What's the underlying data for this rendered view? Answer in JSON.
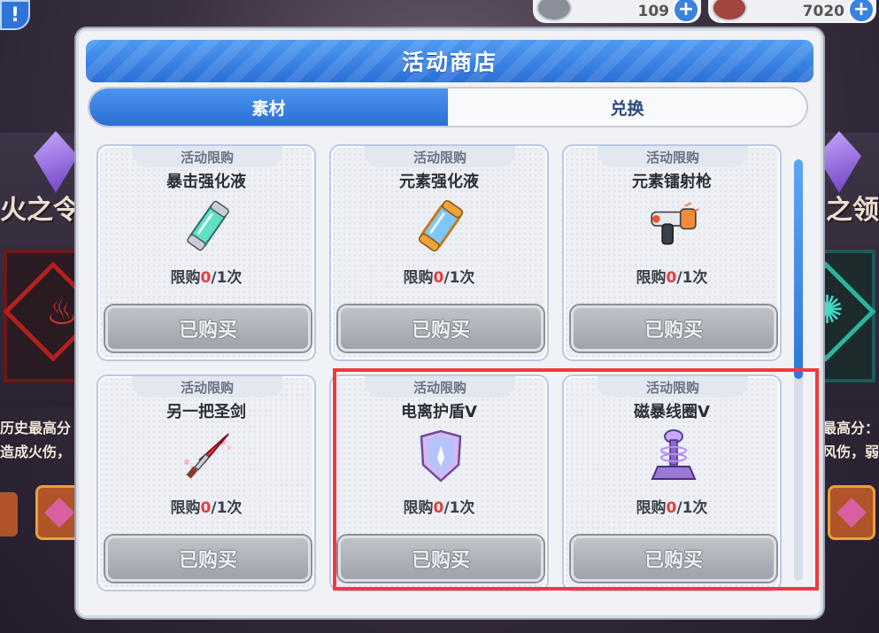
{
  "resources": {
    "key_count": "109",
    "gem_count": "7020"
  },
  "background": {
    "title_left": "火之令",
    "title_right": "之领",
    "text_left_1": "历史最高分",
    "text_left_2": "造成火伤，",
    "text_right_1": "最高分：",
    "text_right_2": "风伤，弱"
  },
  "modal": {
    "title": "活动商店",
    "tabs": [
      {
        "label": "素材",
        "active": true
      },
      {
        "label": "兑换",
        "active": false
      }
    ]
  },
  "shop": {
    "items": [
      {
        "tag": "活动限购",
        "name": "暴击强化液",
        "icon": "green-vial-icon",
        "limit_prefix": "限购",
        "bought": "0",
        "limit_suffix": "/1次",
        "button": "已购买"
      },
      {
        "tag": "活动限购",
        "name": "元素强化液",
        "icon": "blue-vial-icon",
        "limit_prefix": "限购",
        "bought": "0",
        "limit_suffix": "/1次",
        "button": "已购买"
      },
      {
        "tag": "活动限购",
        "name": "元素镭射枪",
        "icon": "laser-gun-icon",
        "limit_prefix": "限购",
        "bought": "0",
        "limit_suffix": "/1次",
        "button": "已购买"
      },
      {
        "tag": "活动限购",
        "name": "另一把圣剑",
        "icon": "sword-icon",
        "limit_prefix": "限购",
        "bought": "0",
        "limit_suffix": "/1次",
        "button": "已购买"
      },
      {
        "tag": "活动限购",
        "name": "电离护盾Ⅴ",
        "icon": "shield-icon",
        "limit_prefix": "限购",
        "bought": "0",
        "limit_suffix": "/1次",
        "button": "已购买"
      },
      {
        "tag": "活动限购",
        "name": "磁暴线圈Ⅴ",
        "icon": "tesla-coil-icon",
        "limit_prefix": "限购",
        "bought": "0",
        "limit_suffix": "/1次",
        "button": "已购买"
      }
    ]
  },
  "colors": {
    "accent": "#2c6fd4",
    "highlight": "#ef3b3b",
    "limit_zero": "#e63b3b"
  }
}
